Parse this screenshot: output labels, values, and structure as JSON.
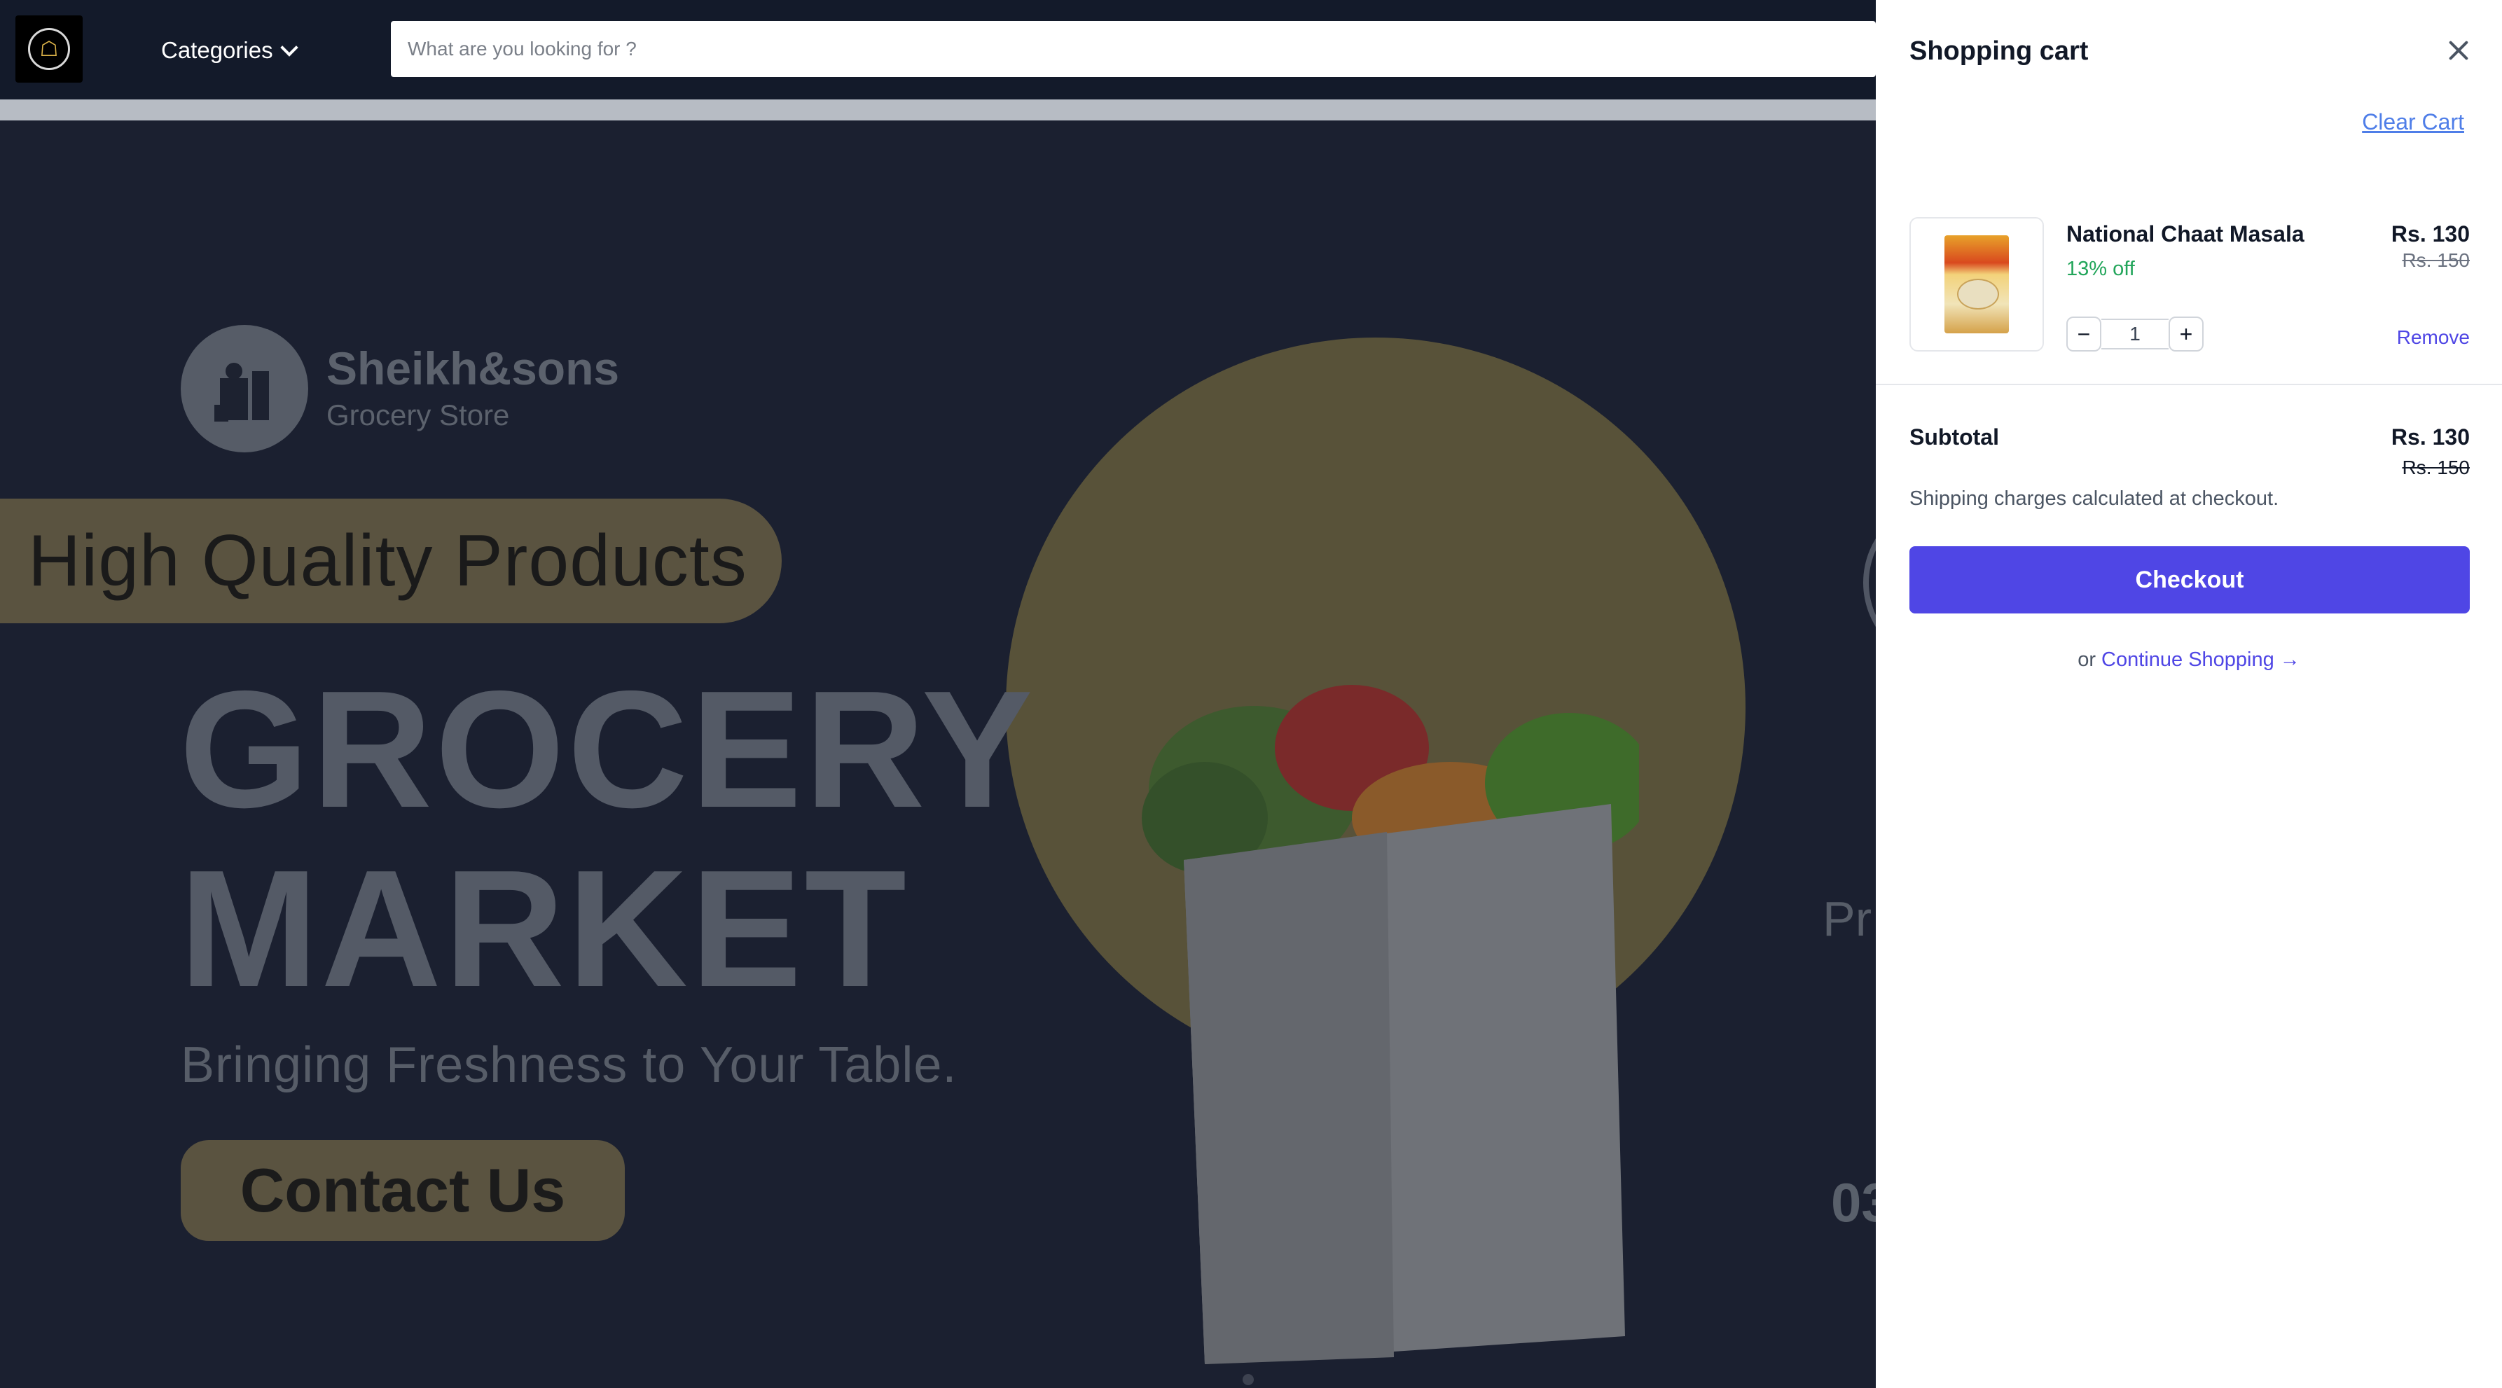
{
  "header": {
    "categories_label": "Categories",
    "search_placeholder": "What are you looking for ?"
  },
  "hero": {
    "brand_name": "Sheikh&sons",
    "brand_sub": "Grocery Store",
    "badge": "High Quality Products",
    "title_line1": "GROCERY",
    "title_line2": "MARKET",
    "tagline": "Bringing Freshness to Your Table.",
    "contact_label": "Contact Us",
    "partial_1": "Pr",
    "partial_2": "03"
  },
  "cart": {
    "title": "Shopping cart",
    "clear_label": "Clear Cart",
    "items": [
      {
        "name": "National Chaat Masala",
        "discount": "13% off",
        "price": "Rs. 130",
        "old_price": "Rs. 150",
        "quantity": "1",
        "remove_label": "Remove"
      }
    ],
    "subtotal_label": "Subtotal",
    "subtotal": "Rs. 130",
    "subtotal_old": "Rs. 150",
    "shipping_note": "Shipping charges calculated at checkout.",
    "checkout_label": "Checkout",
    "continue_prefix": "or",
    "continue_label": "Continue Shopping →"
  },
  "colors": {
    "accent": "#4f46e5",
    "discount": "#22a55a",
    "header_bg": "#131a2a",
    "overlay_gold": "#5a5340"
  }
}
